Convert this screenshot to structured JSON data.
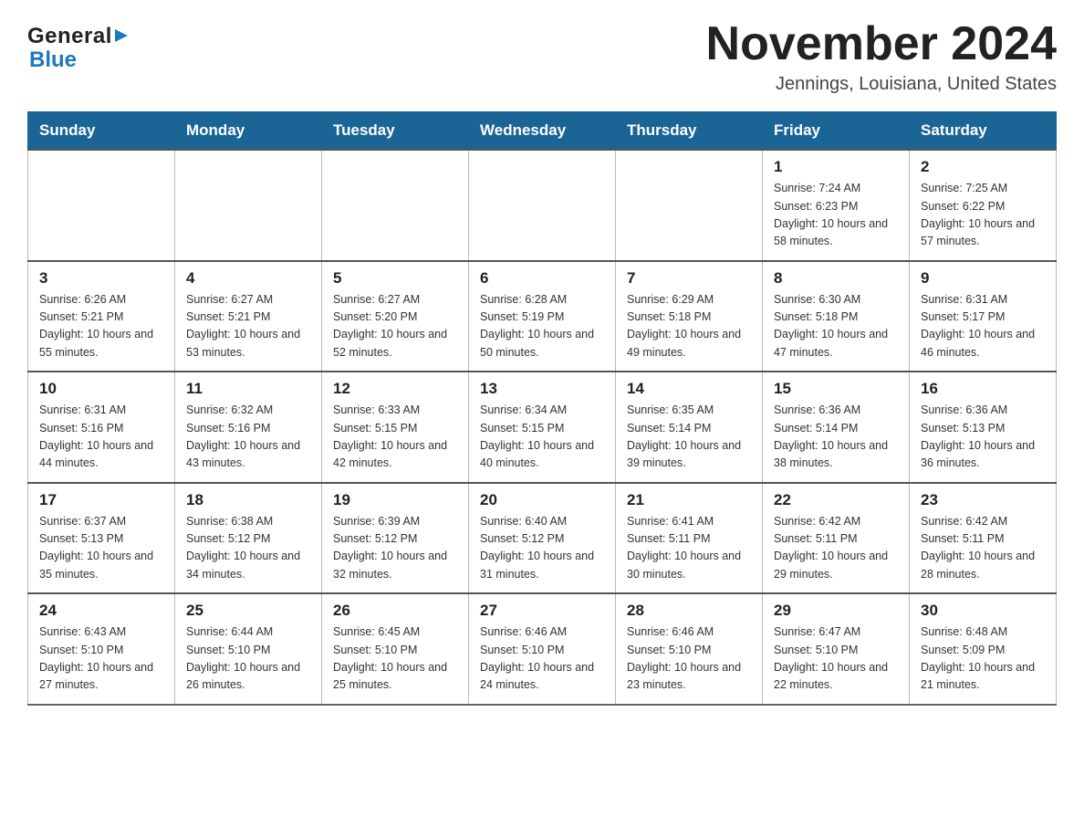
{
  "header": {
    "logo": {
      "general": "General",
      "blue": "Blue",
      "arrow": "▶"
    },
    "month_title": "November 2024",
    "location": "Jennings, Louisiana, United States"
  },
  "weekdays": [
    "Sunday",
    "Monday",
    "Tuesday",
    "Wednesday",
    "Thursday",
    "Friday",
    "Saturday"
  ],
  "weeks": [
    {
      "days": [
        {
          "num": "",
          "info": ""
        },
        {
          "num": "",
          "info": ""
        },
        {
          "num": "",
          "info": ""
        },
        {
          "num": "",
          "info": ""
        },
        {
          "num": "",
          "info": ""
        },
        {
          "num": "1",
          "info": "Sunrise: 7:24 AM\nSunset: 6:23 PM\nDaylight: 10 hours and 58 minutes."
        },
        {
          "num": "2",
          "info": "Sunrise: 7:25 AM\nSunset: 6:22 PM\nDaylight: 10 hours and 57 minutes."
        }
      ]
    },
    {
      "days": [
        {
          "num": "3",
          "info": "Sunrise: 6:26 AM\nSunset: 5:21 PM\nDaylight: 10 hours and 55 minutes."
        },
        {
          "num": "4",
          "info": "Sunrise: 6:27 AM\nSunset: 5:21 PM\nDaylight: 10 hours and 53 minutes."
        },
        {
          "num": "5",
          "info": "Sunrise: 6:27 AM\nSunset: 5:20 PM\nDaylight: 10 hours and 52 minutes."
        },
        {
          "num": "6",
          "info": "Sunrise: 6:28 AM\nSunset: 5:19 PM\nDaylight: 10 hours and 50 minutes."
        },
        {
          "num": "7",
          "info": "Sunrise: 6:29 AM\nSunset: 5:18 PM\nDaylight: 10 hours and 49 minutes."
        },
        {
          "num": "8",
          "info": "Sunrise: 6:30 AM\nSunset: 5:18 PM\nDaylight: 10 hours and 47 minutes."
        },
        {
          "num": "9",
          "info": "Sunrise: 6:31 AM\nSunset: 5:17 PM\nDaylight: 10 hours and 46 minutes."
        }
      ]
    },
    {
      "days": [
        {
          "num": "10",
          "info": "Sunrise: 6:31 AM\nSunset: 5:16 PM\nDaylight: 10 hours and 44 minutes."
        },
        {
          "num": "11",
          "info": "Sunrise: 6:32 AM\nSunset: 5:16 PM\nDaylight: 10 hours and 43 minutes."
        },
        {
          "num": "12",
          "info": "Sunrise: 6:33 AM\nSunset: 5:15 PM\nDaylight: 10 hours and 42 minutes."
        },
        {
          "num": "13",
          "info": "Sunrise: 6:34 AM\nSunset: 5:15 PM\nDaylight: 10 hours and 40 minutes."
        },
        {
          "num": "14",
          "info": "Sunrise: 6:35 AM\nSunset: 5:14 PM\nDaylight: 10 hours and 39 minutes."
        },
        {
          "num": "15",
          "info": "Sunrise: 6:36 AM\nSunset: 5:14 PM\nDaylight: 10 hours and 38 minutes."
        },
        {
          "num": "16",
          "info": "Sunrise: 6:36 AM\nSunset: 5:13 PM\nDaylight: 10 hours and 36 minutes."
        }
      ]
    },
    {
      "days": [
        {
          "num": "17",
          "info": "Sunrise: 6:37 AM\nSunset: 5:13 PM\nDaylight: 10 hours and 35 minutes."
        },
        {
          "num": "18",
          "info": "Sunrise: 6:38 AM\nSunset: 5:12 PM\nDaylight: 10 hours and 34 minutes."
        },
        {
          "num": "19",
          "info": "Sunrise: 6:39 AM\nSunset: 5:12 PM\nDaylight: 10 hours and 32 minutes."
        },
        {
          "num": "20",
          "info": "Sunrise: 6:40 AM\nSunset: 5:12 PM\nDaylight: 10 hours and 31 minutes."
        },
        {
          "num": "21",
          "info": "Sunrise: 6:41 AM\nSunset: 5:11 PM\nDaylight: 10 hours and 30 minutes."
        },
        {
          "num": "22",
          "info": "Sunrise: 6:42 AM\nSunset: 5:11 PM\nDaylight: 10 hours and 29 minutes."
        },
        {
          "num": "23",
          "info": "Sunrise: 6:42 AM\nSunset: 5:11 PM\nDaylight: 10 hours and 28 minutes."
        }
      ]
    },
    {
      "days": [
        {
          "num": "24",
          "info": "Sunrise: 6:43 AM\nSunset: 5:10 PM\nDaylight: 10 hours and 27 minutes."
        },
        {
          "num": "25",
          "info": "Sunrise: 6:44 AM\nSunset: 5:10 PM\nDaylight: 10 hours and 26 minutes."
        },
        {
          "num": "26",
          "info": "Sunrise: 6:45 AM\nSunset: 5:10 PM\nDaylight: 10 hours and 25 minutes."
        },
        {
          "num": "27",
          "info": "Sunrise: 6:46 AM\nSunset: 5:10 PM\nDaylight: 10 hours and 24 minutes."
        },
        {
          "num": "28",
          "info": "Sunrise: 6:46 AM\nSunset: 5:10 PM\nDaylight: 10 hours and 23 minutes."
        },
        {
          "num": "29",
          "info": "Sunrise: 6:47 AM\nSunset: 5:10 PM\nDaylight: 10 hours and 22 minutes."
        },
        {
          "num": "30",
          "info": "Sunrise: 6:48 AM\nSunset: 5:09 PM\nDaylight: 10 hours and 21 minutes."
        }
      ]
    }
  ]
}
